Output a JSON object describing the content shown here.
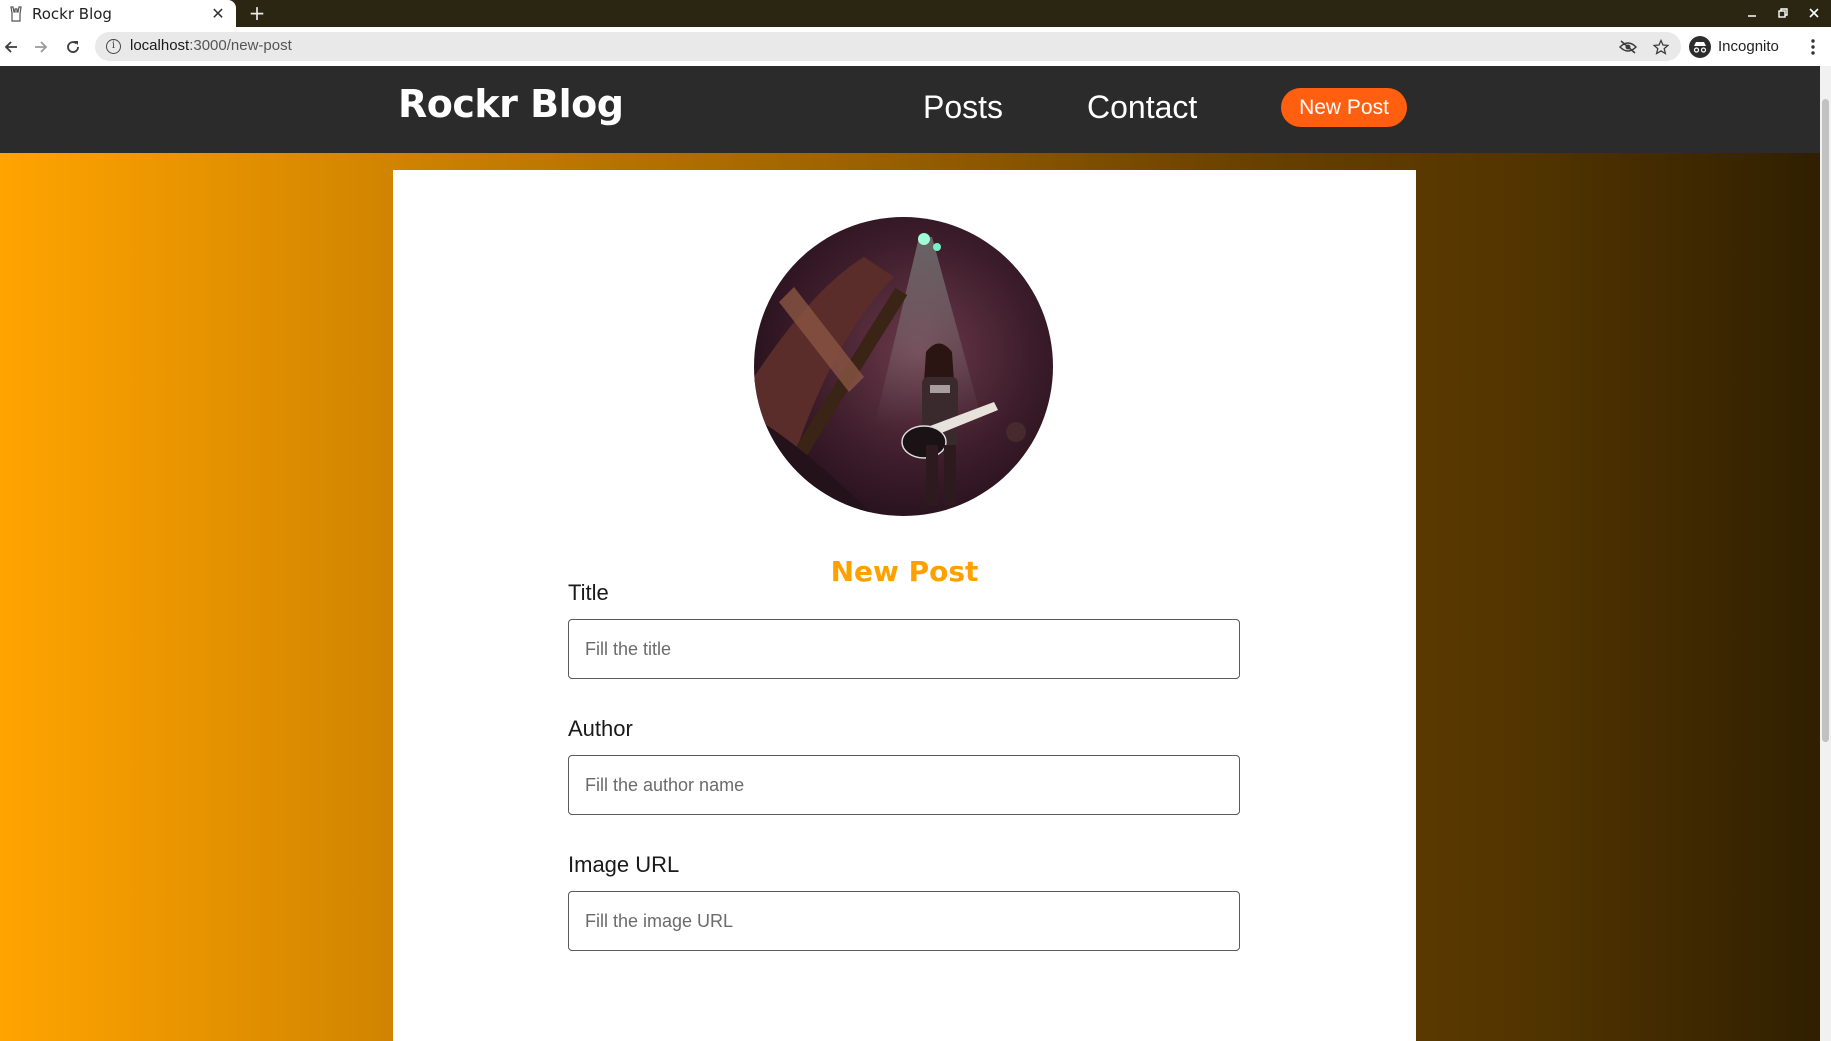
{
  "browser": {
    "tab_title": "Rockr Blog",
    "tab_close_glyph": "✕",
    "new_tab_glyph": "+",
    "url_host": "localhost",
    "url_path": ":3000/new-post",
    "profile_label": "Incognito",
    "icons": [
      "back-icon",
      "forward-icon",
      "reload-icon",
      "info-icon",
      "eye-off-icon",
      "star-icon",
      "incognito-icon",
      "menu-icon",
      "minimize-icon",
      "restore-icon",
      "close-window-icon"
    ]
  },
  "header": {
    "logo": "Rockr Blog",
    "nav": [
      "Posts",
      "Contact"
    ],
    "cta_label": "New Post",
    "colors": {
      "background": "#2b2b2b",
      "cta": "#ff5f0e"
    }
  },
  "form": {
    "heading": "New Post",
    "heading_color": "#ffa000",
    "fields": [
      {
        "label": "Title",
        "placeholder": "Fill the title",
        "value": ""
      },
      {
        "label": "Author",
        "placeholder": "Fill the author name",
        "value": ""
      },
      {
        "label": "Image URL",
        "placeholder": "Fill the image URL",
        "value": ""
      }
    ]
  },
  "page": {
    "background_gradient": [
      "#ffa400",
      "#2e1e00"
    ]
  }
}
